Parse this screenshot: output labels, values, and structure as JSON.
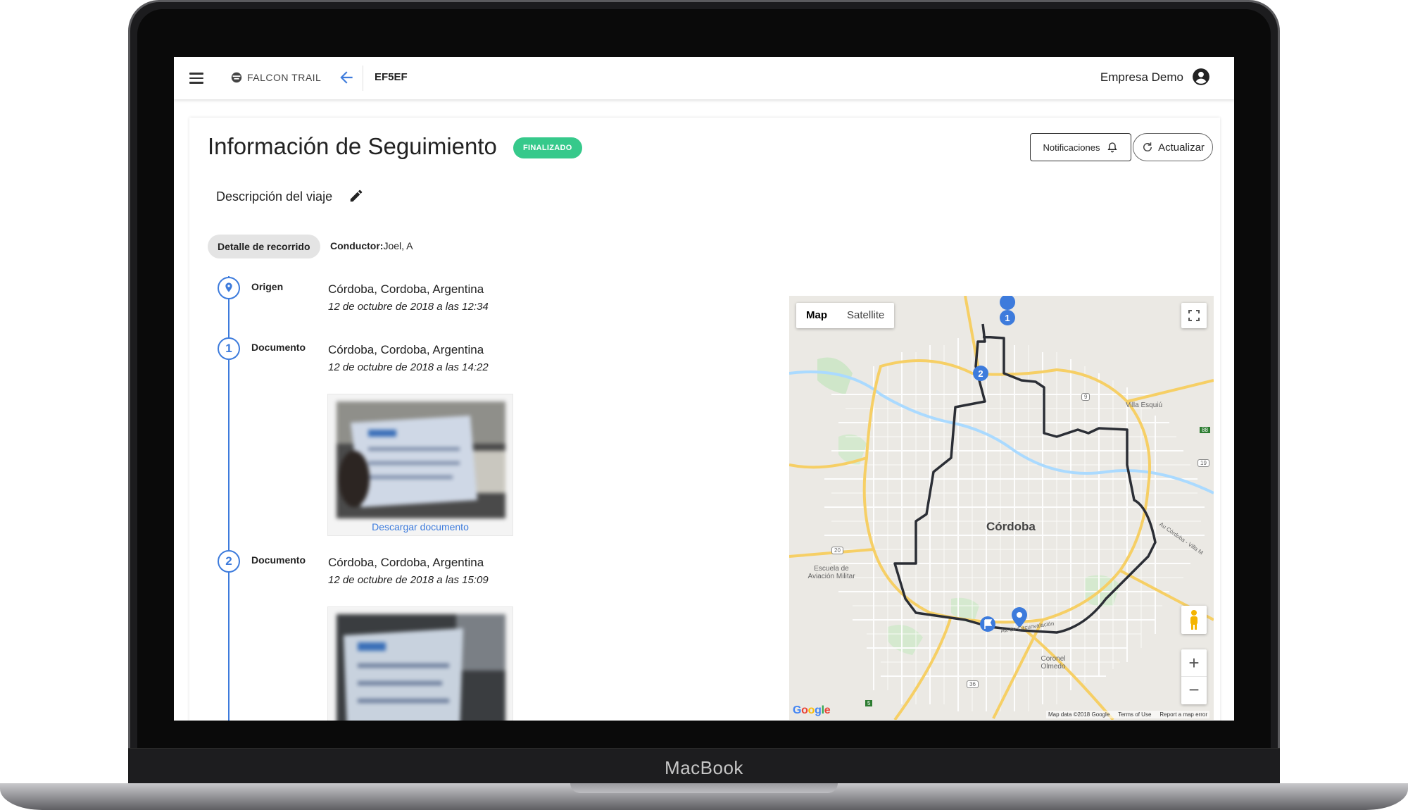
{
  "device": {
    "label": "MacBook"
  },
  "header": {
    "brand": "FALCON TRAIL",
    "trip_code": "EF5EF",
    "company": "Empresa Demo"
  },
  "page": {
    "title": "Información de Seguimiento",
    "status_badge": "FINALIZADO",
    "notifications_label": "Notificaciones",
    "refresh_label": "Actualizar",
    "description_label": "Descripción del viaje",
    "route_detail_chip": "Detalle de recorrido",
    "driver_label": "Conductor:",
    "driver_name": "Joel, A"
  },
  "timeline": [
    {
      "marker": "",
      "type": "Origen",
      "place": "Córdoba, Cordoba, Argentina",
      "time": "12 de octubre de 2018 a las 12:34"
    },
    {
      "marker": "1",
      "type": "Documento",
      "place": "Córdoba, Cordoba, Argentina",
      "time": "12 de octubre de 2018 a las 14:22",
      "download": "Descargar documento"
    },
    {
      "marker": "2",
      "type": "Documento",
      "place": "Córdoba, Cordoba, Argentina",
      "time": "12 de octubre de 2018 a las 15:09"
    }
  ],
  "map": {
    "tabs": {
      "map": "Map",
      "satellite": "Satellite"
    },
    "city": "Córdoba",
    "labels": {
      "villa": "Villa Esquiú",
      "escuela": "Escuela de Aviación Militar",
      "coronel": "Coronel Olmedo",
      "avenida": "Av. de Circunvalación",
      "autopista": "Au Córdoba - Villa M"
    },
    "route_markers": [
      "1",
      "2"
    ],
    "road_shields": [
      "9",
      "88",
      "19",
      "20",
      "36",
      "5"
    ],
    "footer": {
      "data": "Map data ©2018 Google",
      "terms": "Terms of Use",
      "report": "Report a map error"
    },
    "zoom_in": "+",
    "zoom_out": "−",
    "google": "Google"
  }
}
